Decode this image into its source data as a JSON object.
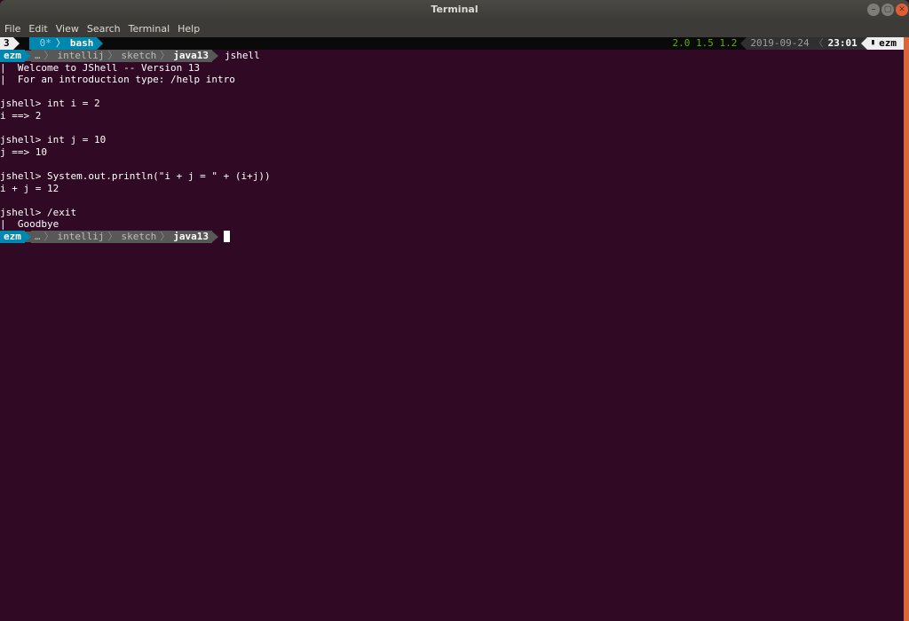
{
  "window": {
    "title": "Terminal"
  },
  "window_controls": {
    "minimize": "–",
    "maximize": "▢",
    "close": "✕"
  },
  "menu": [
    "File",
    "Edit",
    "View",
    "Search",
    "Terminal",
    "Help"
  ],
  "tmux": {
    "session": "3",
    "windows": [
      {
        "label": "0*"
      },
      {
        "label": "bash"
      }
    ],
    "load": "2.0 1.5 1.2",
    "date": "2019-09-24",
    "time": "23:01",
    "lock_icon": "🔒",
    "user": "ezm"
  },
  "prompt": {
    "user": "ezm",
    "path": [
      "…",
      "intellij",
      "sketch",
      "java13"
    ]
  },
  "terminal_lines": [
    {
      "type": "prompt",
      "command": "jshell"
    },
    {
      "type": "text",
      "text": "|  Welcome to JShell -- Version 13"
    },
    {
      "type": "text",
      "text": "|  For an introduction type: /help intro"
    },
    {
      "type": "text",
      "text": ""
    },
    {
      "type": "text",
      "text": "jshell> int i = 2"
    },
    {
      "type": "text",
      "text": "i ==> 2"
    },
    {
      "type": "text",
      "text": ""
    },
    {
      "type": "text",
      "text": "jshell> int j = 10"
    },
    {
      "type": "text",
      "text": "j ==> 10"
    },
    {
      "type": "text",
      "text": ""
    },
    {
      "type": "text",
      "text": "jshell> System.out.println(\"i + j = \" + (i+j))"
    },
    {
      "type": "text",
      "text": "i + j = 12"
    },
    {
      "type": "text",
      "text": ""
    },
    {
      "type": "text",
      "text": "jshell> /exit"
    },
    {
      "type": "text",
      "text": "|  Goodbye"
    },
    {
      "type": "prompt",
      "command": "",
      "cursor": true
    }
  ],
  "colors": {
    "terminal_bg": "#300a24",
    "accent_blue": "#0087af",
    "segment_gray": "#585858",
    "load_green": "#5faf00",
    "close_orange": "#e35d32"
  }
}
